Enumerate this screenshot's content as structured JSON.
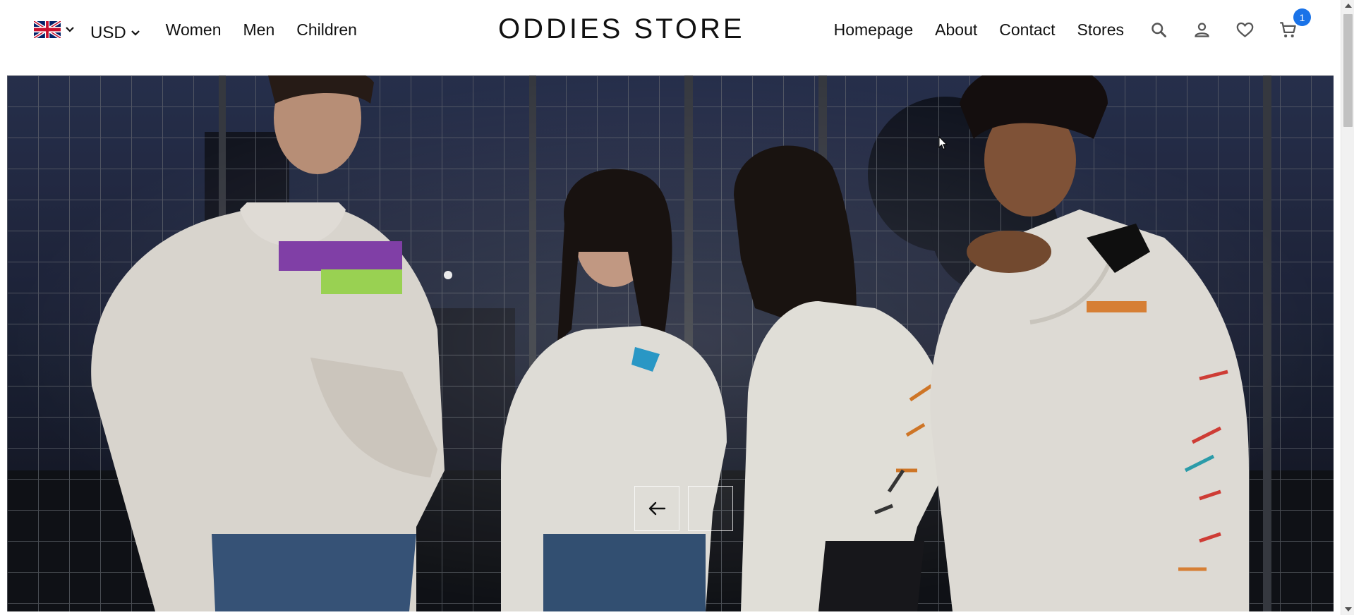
{
  "header": {
    "language_flag": "uk-flag",
    "currency": {
      "selected": "USD"
    },
    "left_links": [
      "Women",
      "Men",
      "Children"
    ],
    "brand": "ODDIES STORE",
    "right_links": [
      "Homepage",
      "About",
      "Contact",
      "Stores"
    ],
    "icons": [
      "search-icon",
      "user-icon",
      "heart-icon",
      "cart-icon"
    ],
    "cart_count": "1",
    "badge_color": "#1a73e8"
  },
  "hero": {
    "prev_icon": "arrow-left-icon",
    "next_icon": ""
  }
}
